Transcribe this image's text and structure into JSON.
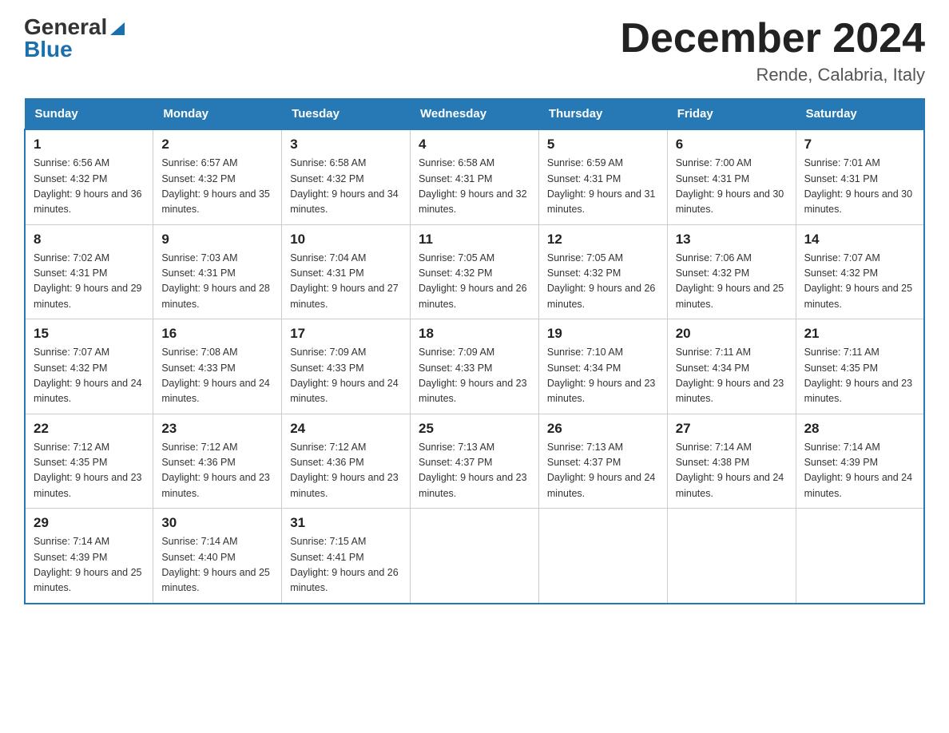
{
  "header": {
    "logo_general": "General",
    "logo_blue": "Blue",
    "month_title": "December 2024",
    "location": "Rende, Calabria, Italy"
  },
  "weekdays": [
    "Sunday",
    "Monday",
    "Tuesday",
    "Wednesday",
    "Thursday",
    "Friday",
    "Saturday"
  ],
  "weeks": [
    [
      {
        "day": "1",
        "sunrise": "6:56 AM",
        "sunset": "4:32 PM",
        "daylight": "9 hours and 36 minutes."
      },
      {
        "day": "2",
        "sunrise": "6:57 AM",
        "sunset": "4:32 PM",
        "daylight": "9 hours and 35 minutes."
      },
      {
        "day": "3",
        "sunrise": "6:58 AM",
        "sunset": "4:32 PM",
        "daylight": "9 hours and 34 minutes."
      },
      {
        "day": "4",
        "sunrise": "6:58 AM",
        "sunset": "4:31 PM",
        "daylight": "9 hours and 32 minutes."
      },
      {
        "day": "5",
        "sunrise": "6:59 AM",
        "sunset": "4:31 PM",
        "daylight": "9 hours and 31 minutes."
      },
      {
        "day": "6",
        "sunrise": "7:00 AM",
        "sunset": "4:31 PM",
        "daylight": "9 hours and 30 minutes."
      },
      {
        "day": "7",
        "sunrise": "7:01 AM",
        "sunset": "4:31 PM",
        "daylight": "9 hours and 30 minutes."
      }
    ],
    [
      {
        "day": "8",
        "sunrise": "7:02 AM",
        "sunset": "4:31 PM",
        "daylight": "9 hours and 29 minutes."
      },
      {
        "day": "9",
        "sunrise": "7:03 AM",
        "sunset": "4:31 PM",
        "daylight": "9 hours and 28 minutes."
      },
      {
        "day": "10",
        "sunrise": "7:04 AM",
        "sunset": "4:31 PM",
        "daylight": "9 hours and 27 minutes."
      },
      {
        "day": "11",
        "sunrise": "7:05 AM",
        "sunset": "4:32 PM",
        "daylight": "9 hours and 26 minutes."
      },
      {
        "day": "12",
        "sunrise": "7:05 AM",
        "sunset": "4:32 PM",
        "daylight": "9 hours and 26 minutes."
      },
      {
        "day": "13",
        "sunrise": "7:06 AM",
        "sunset": "4:32 PM",
        "daylight": "9 hours and 25 minutes."
      },
      {
        "day": "14",
        "sunrise": "7:07 AM",
        "sunset": "4:32 PM",
        "daylight": "9 hours and 25 minutes."
      }
    ],
    [
      {
        "day": "15",
        "sunrise": "7:07 AM",
        "sunset": "4:32 PM",
        "daylight": "9 hours and 24 minutes."
      },
      {
        "day": "16",
        "sunrise": "7:08 AM",
        "sunset": "4:33 PM",
        "daylight": "9 hours and 24 minutes."
      },
      {
        "day": "17",
        "sunrise": "7:09 AM",
        "sunset": "4:33 PM",
        "daylight": "9 hours and 24 minutes."
      },
      {
        "day": "18",
        "sunrise": "7:09 AM",
        "sunset": "4:33 PM",
        "daylight": "9 hours and 23 minutes."
      },
      {
        "day": "19",
        "sunrise": "7:10 AM",
        "sunset": "4:34 PM",
        "daylight": "9 hours and 23 minutes."
      },
      {
        "day": "20",
        "sunrise": "7:11 AM",
        "sunset": "4:34 PM",
        "daylight": "9 hours and 23 minutes."
      },
      {
        "day": "21",
        "sunrise": "7:11 AM",
        "sunset": "4:35 PM",
        "daylight": "9 hours and 23 minutes."
      }
    ],
    [
      {
        "day": "22",
        "sunrise": "7:12 AM",
        "sunset": "4:35 PM",
        "daylight": "9 hours and 23 minutes."
      },
      {
        "day": "23",
        "sunrise": "7:12 AM",
        "sunset": "4:36 PM",
        "daylight": "9 hours and 23 minutes."
      },
      {
        "day": "24",
        "sunrise": "7:12 AM",
        "sunset": "4:36 PM",
        "daylight": "9 hours and 23 minutes."
      },
      {
        "day": "25",
        "sunrise": "7:13 AM",
        "sunset": "4:37 PM",
        "daylight": "9 hours and 23 minutes."
      },
      {
        "day": "26",
        "sunrise": "7:13 AM",
        "sunset": "4:37 PM",
        "daylight": "9 hours and 24 minutes."
      },
      {
        "day": "27",
        "sunrise": "7:14 AM",
        "sunset": "4:38 PM",
        "daylight": "9 hours and 24 minutes."
      },
      {
        "day": "28",
        "sunrise": "7:14 AM",
        "sunset": "4:39 PM",
        "daylight": "9 hours and 24 minutes."
      }
    ],
    [
      {
        "day": "29",
        "sunrise": "7:14 AM",
        "sunset": "4:39 PM",
        "daylight": "9 hours and 25 minutes."
      },
      {
        "day": "30",
        "sunrise": "7:14 AM",
        "sunset": "4:40 PM",
        "daylight": "9 hours and 25 minutes."
      },
      {
        "day": "31",
        "sunrise": "7:15 AM",
        "sunset": "4:41 PM",
        "daylight": "9 hours and 26 minutes."
      },
      null,
      null,
      null,
      null
    ]
  ],
  "labels": {
    "sunrise": "Sunrise:",
    "sunset": "Sunset:",
    "daylight": "Daylight:"
  }
}
